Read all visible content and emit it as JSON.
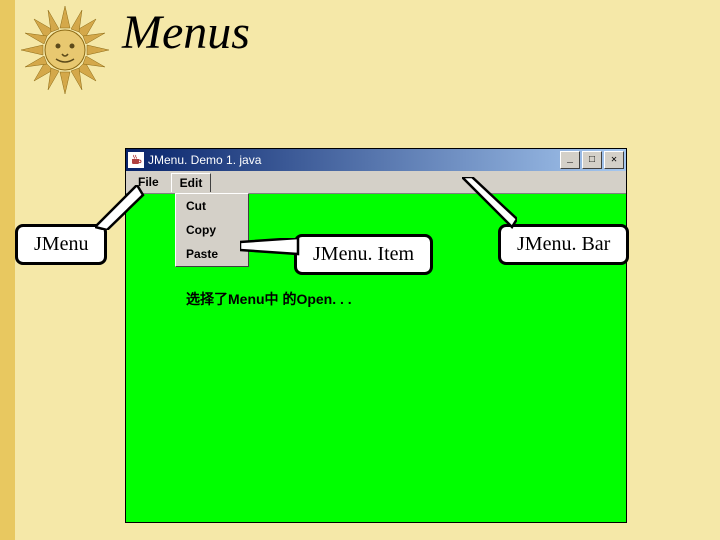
{
  "slide": {
    "title": "Menus"
  },
  "callouts": {
    "jmenu": "JMenu",
    "jmenuitem": "JMenu. Item",
    "jmenubar": "JMenu. Bar"
  },
  "window": {
    "title": "JMenu. Demo 1. java",
    "menubar": {
      "file": "File",
      "edit": "Edit"
    },
    "dropdown": {
      "cut": "Cut",
      "copy": "Copy",
      "paste": "Paste"
    },
    "status": "选择了Menu中 的Open. . ."
  }
}
